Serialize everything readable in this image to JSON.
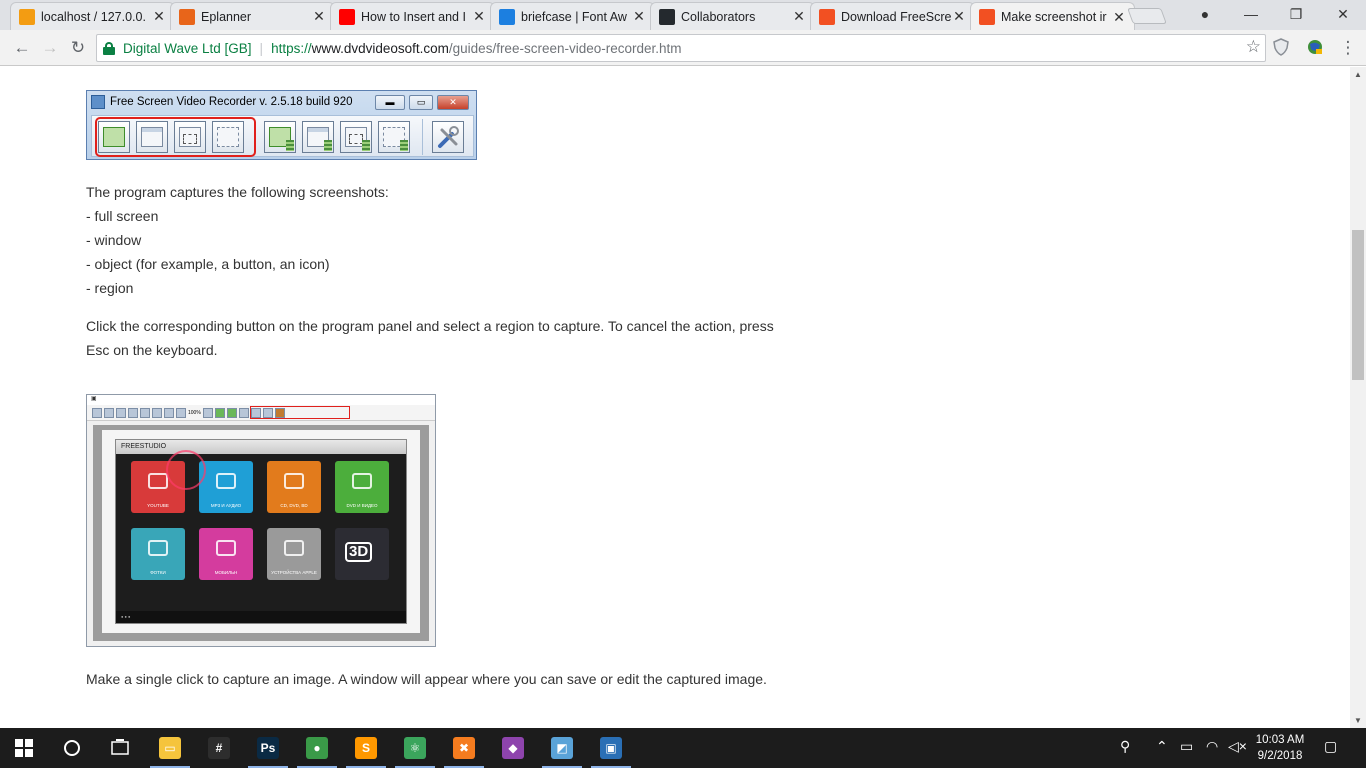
{
  "browser": {
    "tabs": [
      {
        "title": "localhost / 127.0.0.",
        "favicon": "phpmyadmin-icon",
        "color": "#f39c12",
        "active": false
      },
      {
        "title": "Eplanner",
        "favicon": "eplanner-icon",
        "color": "#e8651a",
        "active": false
      },
      {
        "title": "How to Insert and I",
        "favicon": "youtube-icon",
        "color": "#ff0000",
        "active": false
      },
      {
        "title": "briefcase | Font Aw",
        "favicon": "flag-icon",
        "color": "#1c7fe0",
        "active": false
      },
      {
        "title": "Collaborators",
        "favicon": "github-icon",
        "color": "#24292e",
        "active": false
      },
      {
        "title": "Download FreeScre",
        "favicon": "microsoft-icon",
        "color": "#f25022",
        "active": false
      },
      {
        "title": "Make screenshot ir",
        "favicon": "microsoft-icon",
        "color": "#f25022",
        "active": true
      }
    ],
    "close_glyph": "✕",
    "window_controls": {
      "minimize": "—",
      "maximize": "❐",
      "close": "✕"
    },
    "nav": {
      "back": "←",
      "forward": "→",
      "reload": "↻"
    },
    "address": {
      "cert_name": "Digital Wave Ltd [GB]",
      "separator": "|",
      "scheme": "https://",
      "host": "www.dvdvideosoft.com",
      "path": "/guides/free-screen-video-recorder.htm"
    },
    "star_glyph": "☆"
  },
  "page": {
    "recorder": {
      "title": "Free Screen Video Recorder  v. 2.5.18 build 920",
      "buttons": [
        "full-screen-capture",
        "window-capture",
        "object-capture",
        "region-capture",
        "full-screen-record",
        "window-record",
        "object-record",
        "region-record",
        "settings"
      ]
    },
    "intro": "The program captures the following screenshots:",
    "list": [
      "- full screen",
      "- window",
      "- object (for example, a button, an icon)",
      "- region"
    ],
    "para1_line1": "Click the corresponding button on the program panel and select a region to capture. To cancel the action, press",
    "para1_line2": "Esc on the keyboard.",
    "shot2": {
      "window_title": "FREESTUDIO",
      "zoom": "100%",
      "tiles": [
        {
          "label": "YOUTUBE",
          "color": "#d83a3a"
        },
        {
          "label": "MP3 И АУДИО",
          "color": "#1f9fd6"
        },
        {
          "label": "CD, DVD, BD",
          "color": "#e27b1c"
        },
        {
          "label": "DVD И ВИДЕО",
          "color": "#4cae3c"
        },
        {
          "label": "ФОТКИ",
          "color": "#39a6b8"
        },
        {
          "label": "МОБИЛЬН",
          "color": "#d43c9e"
        },
        {
          "label": "УСТРОЙСТВА APPLE",
          "color": "#9a9a9a"
        },
        {
          "label": "3D",
          "color": "#2c2c33"
        }
      ]
    },
    "para2": "Make a single click to capture an image. A window will appear where you can save or edit the captured image."
  },
  "taskbar": {
    "apps": [
      {
        "name": "file-explorer-icon",
        "color": "#f5c43c",
        "glyph": "▭"
      },
      {
        "name": "slack-icon",
        "color": "#2d2d2d",
        "glyph": "#"
      },
      {
        "name": "photoshop-icon",
        "color": "#0a2a44",
        "glyph": "Ps"
      },
      {
        "name": "chrome-icon",
        "color": "#3a9a48",
        "glyph": "●"
      },
      {
        "name": "sublime-icon",
        "color": "#ff9800",
        "glyph": "S"
      },
      {
        "name": "atom-icon",
        "color": "#3ba55c",
        "glyph": "⚛"
      },
      {
        "name": "xampp-icon",
        "color": "#f57c1f",
        "glyph": "✖"
      },
      {
        "name": "sourcetree-icon",
        "color": "#8e44ad",
        "glyph": "◆"
      },
      {
        "name": "notes-icon",
        "color": "#5aa3d8",
        "glyph": "◩"
      },
      {
        "name": "screen-recorder-icon",
        "color": "#2a6fb5",
        "glyph": "▣"
      }
    ],
    "clock_time": "10:03 AM",
    "clock_date": "9/2/2018"
  }
}
